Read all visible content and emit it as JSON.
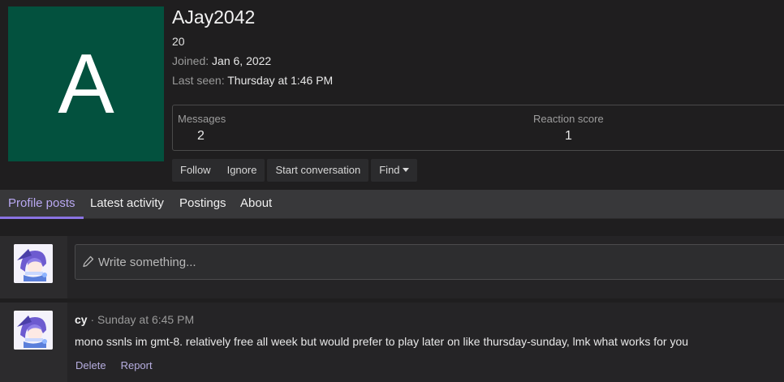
{
  "profile": {
    "avatar_letter": "A",
    "avatar_color": "#03513e",
    "username": "AJay2042",
    "title": "20",
    "joined_label": "Joined:",
    "joined_value": "Jan 6, 2022",
    "last_seen_label": "Last seen:",
    "last_seen_value": "Thursday at 1:46 PM"
  },
  "stats": {
    "messages_label": "Messages",
    "messages_value": "2",
    "reaction_label": "Reaction score",
    "reaction_value": "1"
  },
  "actions": {
    "follow": "Follow",
    "ignore": "Ignore",
    "start_conversation": "Start conversation",
    "find": "Find"
  },
  "tabs": [
    {
      "label": "Profile posts",
      "active": true
    },
    {
      "label": "Latest activity",
      "active": false
    },
    {
      "label": "Postings",
      "active": false
    },
    {
      "label": "About",
      "active": false
    }
  ],
  "composer": {
    "placeholder": "Write something..."
  },
  "post": {
    "author": "cy",
    "separator": "·",
    "time": "Sunday at 6:45 PM",
    "body": "mono ssnls im gmt-8. relatively free all week but would prefer to play later on like thursday-sunday, lmk what works for you",
    "delete_label": "Delete",
    "report_label": "Report"
  },
  "colors": {
    "accent": "#8a73e3",
    "link": "#b7aee0",
    "background": "#1f1e1f"
  }
}
